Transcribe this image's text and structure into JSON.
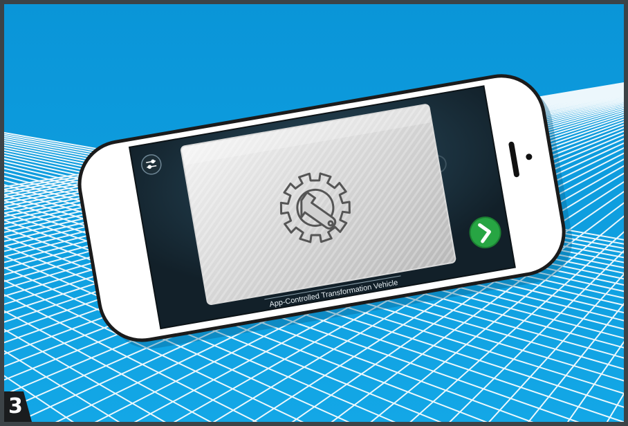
{
  "step_number": "3",
  "app": {
    "caption": "App-Controlled Transformation Vehicle",
    "settings_icon": "sliders-icon",
    "next_icon": "chevron-right-icon",
    "center_icon": "gear-wrench-icon"
  },
  "colors": {
    "sky_blue": "#0d9fe0",
    "grid_line": "#ffffff",
    "screen_dark": "#16232b",
    "next_button": "#27a543"
  }
}
